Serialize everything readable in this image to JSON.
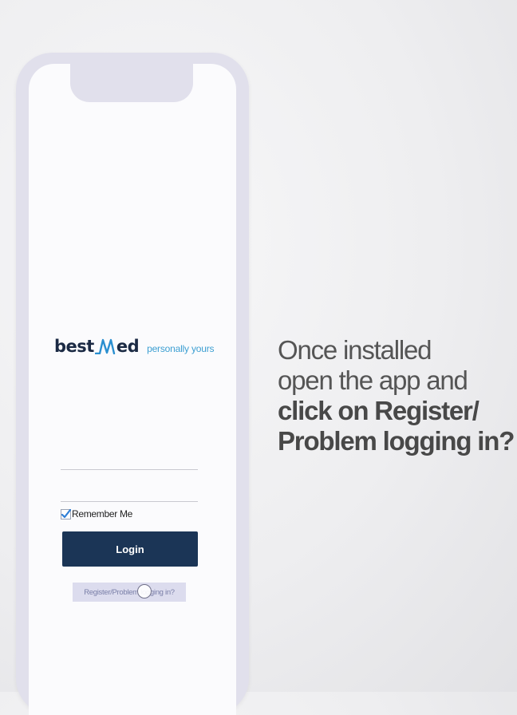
{
  "app": {
    "brand": {
      "name_prefix": "best",
      "name_suffix": "ed",
      "tagline": "personally yours",
      "primary_color": "#1b2a44",
      "accent_color": "#3d9fd2"
    },
    "login_form": {
      "username_value": "",
      "password_value": "",
      "remember_me_label": "Remember Me",
      "remember_me_checked": true,
      "login_label": "Login",
      "register_label": "Register/Problem logging in?",
      "button_color": "#1b3556"
    }
  },
  "instruction": {
    "line1": "Once installed",
    "line2": "open the app and",
    "line3": "click on Register/",
    "line4": "Problem logging in?"
  }
}
